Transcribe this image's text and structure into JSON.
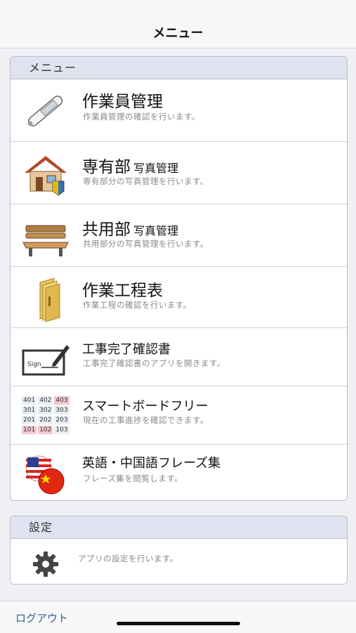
{
  "navbar": {
    "title": "メニュー"
  },
  "menu": {
    "header": "メニュー",
    "items": [
      {
        "title": "作業員管理",
        "title_small": "",
        "subtitle": "作業員管理の確認を行います。",
        "icon": "thermometer-icon"
      },
      {
        "title": "専有部",
        "title_small": "写真管理",
        "subtitle": "専有部分の写真管理を行います。",
        "icon": "house-icon"
      },
      {
        "title": "共用部",
        "title_small": "写真管理",
        "subtitle": "共用部分の写真管理を行います。",
        "icon": "bench-icon"
      },
      {
        "title": "作業工程表",
        "title_small": "",
        "subtitle": "作業工程の確認を行います。",
        "icon": "folder-icon"
      },
      {
        "title": "工事完了確認書",
        "title_small": "",
        "subtitle": "工事完了確認書のアプリを開きます。",
        "icon": "sign-icon"
      },
      {
        "title": "スマートボードフリー",
        "title_small": "",
        "subtitle": "現在の工事進捗を確認できます。",
        "icon": "room-grid-icon",
        "grid": [
          [
            "401",
            "402",
            "403"
          ],
          [
            "301",
            "302",
            "303"
          ],
          [
            "201",
            "202",
            "203"
          ],
          [
            "101",
            "102",
            "103"
          ]
        ]
      },
      {
        "title": "英語・中国語フレーズ集",
        "title_small": "",
        "subtitle": "フレーズ集を閲覧します。",
        "icon": "flags-icon"
      }
    ]
  },
  "settings": {
    "header": "設定",
    "subtitle": "アプリの設定を行います。",
    "icon": "gear-icon"
  },
  "footer": {
    "logout": "ログアウト"
  },
  "colors": {
    "accent": "#2d5d95",
    "section_header": "#dfe2ef",
    "background": "#efeff4"
  }
}
